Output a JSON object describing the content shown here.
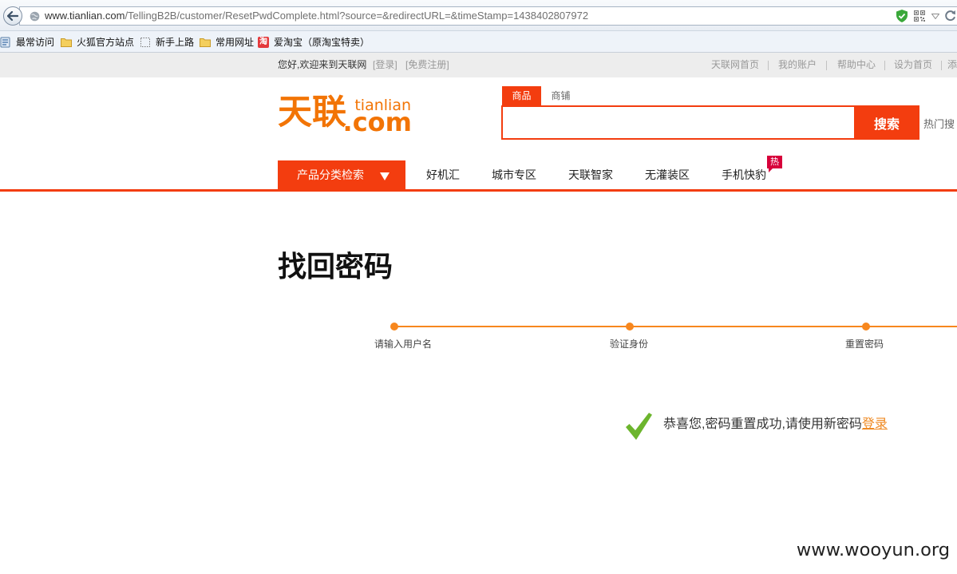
{
  "browser": {
    "url_domain": "www.tianlian.com",
    "url_path": "/TellingB2B/customer/ResetPwdComplete.html?source=&redirectURL=&timeStamp=1438402807972",
    "icons": [
      "back-arrow-icon",
      "globe-icon",
      "shield-icon",
      "qr-code-icon",
      "dropdown-arrow-icon",
      "refresh-icon"
    ]
  },
  "bookmarks": [
    {
      "label": "最常访问",
      "icon": "most-visited-icon"
    },
    {
      "label": "火狐官方站点",
      "icon": "folder-icon"
    },
    {
      "label": "新手上路",
      "icon": "dotted-page-icon"
    },
    {
      "label": "常用网址",
      "icon": "folder-icon"
    },
    {
      "label": "爱淘宝（原淘宝特卖）",
      "icon": "taobao-icon",
      "icon_glyph": "淘"
    }
  ],
  "topbar": {
    "greeting": "您好,欢迎来到天联网",
    "login": "[登录]",
    "register": "[免费注册]",
    "links": [
      "天联网首页",
      "我的账户",
      "帮助中心",
      "设为首页",
      "添"
    ]
  },
  "header": {
    "logo": {
      "cn": "天联",
      "en": "tianlian",
      "domain": ".com"
    },
    "search_tabs": [
      {
        "label": "商品",
        "active": true
      },
      {
        "label": "商铺",
        "active": false
      }
    ],
    "search_button": "搜索",
    "hot_search_label": "热门搜"
  },
  "nav": {
    "category_label": "产品分类检索",
    "category_icon": "dropdown-arrow-icon",
    "items": [
      "好机汇",
      "城市专区",
      "天联智家",
      "无灌装区",
      "手机快豹"
    ],
    "hot_badge": "热"
  },
  "main": {
    "title": "找回密码",
    "steps": [
      "请输入用户名",
      "验证身份",
      "重置密码"
    ],
    "success_icon": "checkmark-icon",
    "success_message": "恭喜您,密码重置成功,请使用新密码",
    "login_link": "登录"
  },
  "watermark": "www.wooyun.org",
  "colors": {
    "accent": "#f33d0f",
    "brand": "#f27405",
    "progress": "#f7871e",
    "link": "#ef8a23",
    "success": "#6cb52d",
    "hot": "#d7003a"
  }
}
